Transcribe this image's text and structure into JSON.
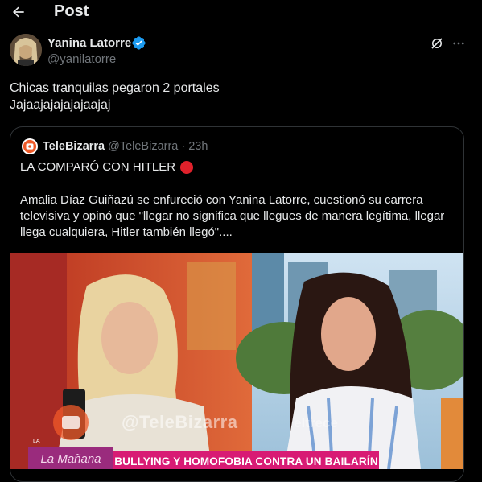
{
  "header": {
    "title": "Post",
    "back_icon": "arrow-left-icon"
  },
  "post": {
    "author_name": "Yanina Latorre",
    "author_handle": "@yanilatorre",
    "verified_color": "#1d9bf0",
    "text_lines": [
      "Chicas tranquilas pegaron 2 portales",
      "Jajaajajajajajaajaj"
    ]
  },
  "quote": {
    "source_name": "TeleBizarra",
    "source_handle": "@TeleBizarra",
    "separator": "·",
    "time": "23h",
    "headline": "LA COMPARÓ CON HITLER",
    "body_lines": [
      "Amalia Díaz Guiñazú se enfureció con Yanina Latorre, cuestionó su carrera",
      "televisiva y opinó que \"llegar no significa que llegues de manera legítima, llegar",
      "llega cualquiera, Hitler también llegó\"...."
    ]
  },
  "media": {
    "watermark": "@TeleBizarra",
    "watermark_secondary": "eltrece",
    "show_name": "La Mañana",
    "show_name_top": "LA",
    "lower_third": "BULLYING Y HOMOFOBIA CONTRA UN BAILARÍN"
  },
  "colors": {
    "background": "#000000",
    "text": "#e7e9ea",
    "muted": "#71767b",
    "border": "#2f3336",
    "accent": "#1d9bf0",
    "alert_red": "#e0212b",
    "banner": "#d81b74"
  }
}
